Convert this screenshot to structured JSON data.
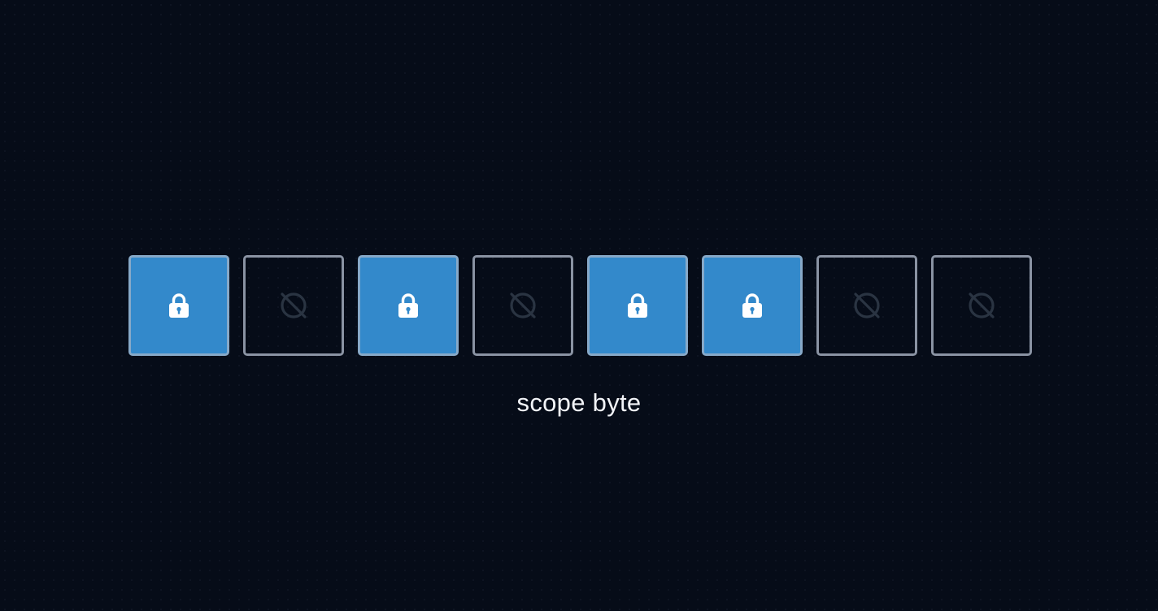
{
  "bits": [
    {
      "state": "on",
      "icon": "lock-icon"
    },
    {
      "state": "off",
      "icon": "slash-circle-icon"
    },
    {
      "state": "on",
      "icon": "lock-icon"
    },
    {
      "state": "off",
      "icon": "slash-circle-icon"
    },
    {
      "state": "on",
      "icon": "lock-icon"
    },
    {
      "state": "on",
      "icon": "lock-icon"
    },
    {
      "state": "off",
      "icon": "slash-circle-icon"
    },
    {
      "state": "off",
      "icon": "slash-circle-icon"
    }
  ],
  "caption": "scope byte",
  "colors": {
    "background": "#060c18",
    "bit_on_fill": "#3389cb",
    "bit_on_border": "#87a9c8",
    "bit_off_border": "#8a93a3",
    "lock_icon": "#ffffff",
    "slash_icon": "#2a3442",
    "caption_text": "#f2f4f8"
  }
}
